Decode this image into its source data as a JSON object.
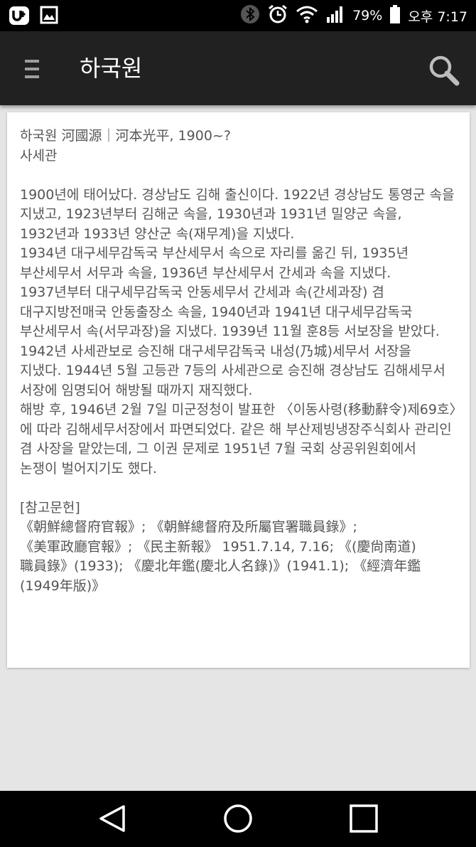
{
  "status_bar": {
    "battery": "79%",
    "time": "오후 7:17",
    "icons": [
      "u-plus-icon",
      "image-icon",
      "bluetooth-icon",
      "alarm-icon",
      "wifi-icon",
      "signal-icon",
      "battery-icon"
    ]
  },
  "app_bar": {
    "title": "하국원",
    "menu_icon": "hamburger-menu-icon",
    "search_icon": "search-icon"
  },
  "article": {
    "text": "하국원 河國源｜河本光平, 1900~?\n사세관\n\n1900년에 태어났다. 경상남도 김해 출신이다. 1922년 경상남도 통영군 속을 지냈고, 1923년부터 김해군 속을, 1930년과 1931년 밀양군 속을, 1932년과 1933년 양산군 속(재무계)을 지냈다.\n1934년 대구세무감독국 부산세무서 속으로 자리를 옮긴 뒤, 1935년 부산세무서 서무과 속을, 1936년 부산세무서 간세과 속을 지냈다. 1937년부터 대구세무감독국 안동세무서 간세과 속(간세과장) 겸 대구지방전매국 안동출장소 속을, 1940년과 1941년 대구세무감독국 부산세무서 속(서무과장)을 지냈다. 1939년 11월 훈8등 서보장을 받았다. 1942년 사세관보로 승진해 대구세무감독국 내성(乃城)세무서 서장을 지냈다. 1944년 5월 고등관 7등의 사세관으로 승진해 경상남도 김해세무서 서장에 임명되어 해방될 때까지 재직했다.\n해방 후, 1946년 2월 7일 미군정청이 발표한 〈이동사령(移動辭令)제69호〉에 따라 김해세무서장에서 파면되었다. 같은 해 부산제빙냉장주식회사 관리인 겸 사장을 맡았는데, 그 이권 문제로 1951년 7월 국회 상공위원회에서 논쟁이 벌어지기도 했다.\n\n[참고문헌]\n《朝鮮總督府官報》; 《朝鮮總督府及所屬官署職員錄》; 《美軍政廳官報》; 《民主新報》 1951.7.14, 7.16; 《(慶尙南道)職員錄》(1933); 《慶北年鑑(慶北人名錄)》(1941.1); 《經濟年鑑(1949年版)》"
  },
  "nav_bar": {
    "buttons": [
      "back-triangle-icon",
      "home-circle-icon",
      "recents-square-icon"
    ]
  }
}
